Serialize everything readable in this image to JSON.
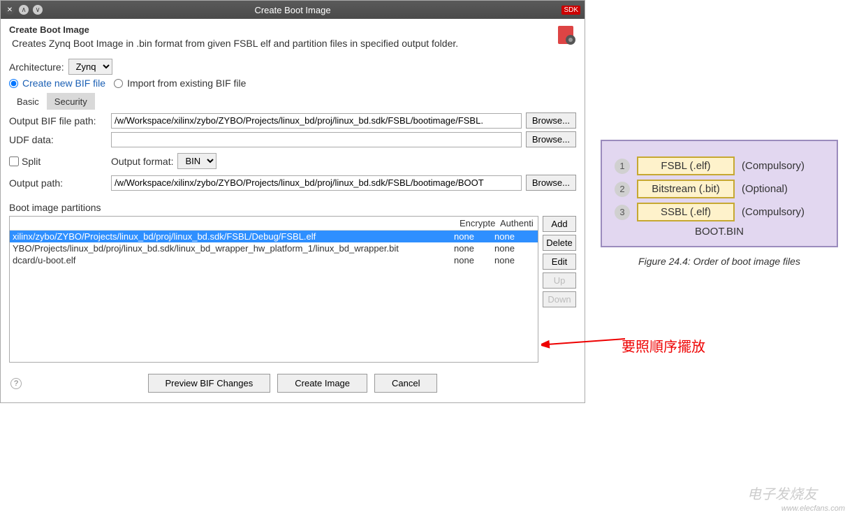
{
  "window": {
    "title": "Create Boot Image",
    "sdk_badge": "SDK"
  },
  "header": {
    "title": "Create Boot Image",
    "description": "Creates Zynq Boot Image in .bin format from given FSBL elf and partition files in specified output folder."
  },
  "arch": {
    "label": "Architecture:",
    "value": "Zynq"
  },
  "bif_mode": {
    "create_label": "Create new BIF file",
    "import_label": "Import from existing BIF file",
    "selected": "create"
  },
  "tabs": {
    "basic": "Basic",
    "security": "Security"
  },
  "form": {
    "bif_path_label": "Output BIF file path:",
    "bif_path_value": "/w/Workspace/xilinx/zybo/ZYBO/Projects/linux_bd/proj/linux_bd.sdk/FSBL/bootimage/FSBL.",
    "udf_label": "UDF data:",
    "udf_value": "",
    "split_label": "Split",
    "output_format_label": "Output format:",
    "output_format_value": "BIN",
    "output_path_label": "Output path:",
    "output_path_value": "/w/Workspace/xilinx/zybo/ZYBO/Projects/linux_bd/proj/linux_bd.sdk/FSBL/bootimage/BOOT",
    "browse": "Browse..."
  },
  "partitions": {
    "label": "Boot image partitions",
    "cols": {
      "encrypted": "Encrypte",
      "auth": "Authenti"
    },
    "rows": [
      {
        "path": "xilinx/zybo/ZYBO/Projects/linux_bd/proj/linux_bd.sdk/FSBL/Debug/FSBL.elf",
        "enc": "none",
        "auth": "none",
        "selected": true
      },
      {
        "path": "YBO/Projects/linux_bd/proj/linux_bd.sdk/linux_bd_wrapper_hw_platform_1/linux_bd_wrapper.bit",
        "enc": "none",
        "auth": "none",
        "selected": false
      },
      {
        "path": "dcard/u-boot.elf",
        "enc": "none",
        "auth": "none",
        "selected": false
      }
    ],
    "buttons": {
      "add": "Add",
      "delete": "Delete",
      "edit": "Edit",
      "up": "Up",
      "down": "Down"
    }
  },
  "footer": {
    "preview": "Preview BIF Changes",
    "create": "Create Image",
    "cancel": "Cancel"
  },
  "figure": {
    "items": [
      {
        "num": "1",
        "box": "FSBL   (.elf)",
        "req": "(Compulsory)"
      },
      {
        "num": "2",
        "box": "Bitstream  (.bit)",
        "req": "(Optional)"
      },
      {
        "num": "3",
        "box": "SSBL   (.elf)",
        "req": "(Compulsory)"
      }
    ],
    "bootbin": "BOOT.BIN",
    "caption": "Figure 24.4:  Order of boot image files"
  },
  "annotation": "要照順序擺放",
  "watermark": {
    "logo": "电子发烧友",
    "url": "www.elecfans.com"
  }
}
